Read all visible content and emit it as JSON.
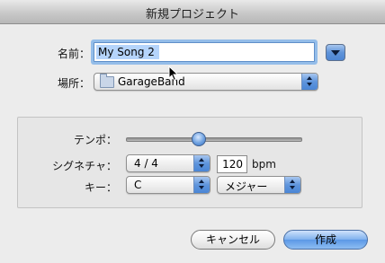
{
  "dialog": {
    "title": "新規プロジェクト"
  },
  "name_row": {
    "label": "名前：",
    "value": "My Song 2"
  },
  "location_row": {
    "label": "場所：",
    "value": "GarageBand"
  },
  "tempo_row": {
    "label": "テンポ：",
    "value_fraction": 0.41
  },
  "signature_row": {
    "label": "シグネチャ：",
    "value": "4 / 4",
    "bpm_value": "120",
    "bpm_unit": "bpm"
  },
  "key_row": {
    "label": "キー：",
    "key_value": "C",
    "scale_value": "メジャー"
  },
  "buttons": {
    "cancel": "キャンセル",
    "create": "作成"
  },
  "icons": {
    "disclosure": "chevron-down-icon",
    "folder": "folder-icon",
    "popup_arrows": "updown-arrows-icon",
    "cursor": "mouse-pointer-icon"
  },
  "colors": {
    "accent": "#5f95dc",
    "focus_ring": "#94bde9"
  }
}
